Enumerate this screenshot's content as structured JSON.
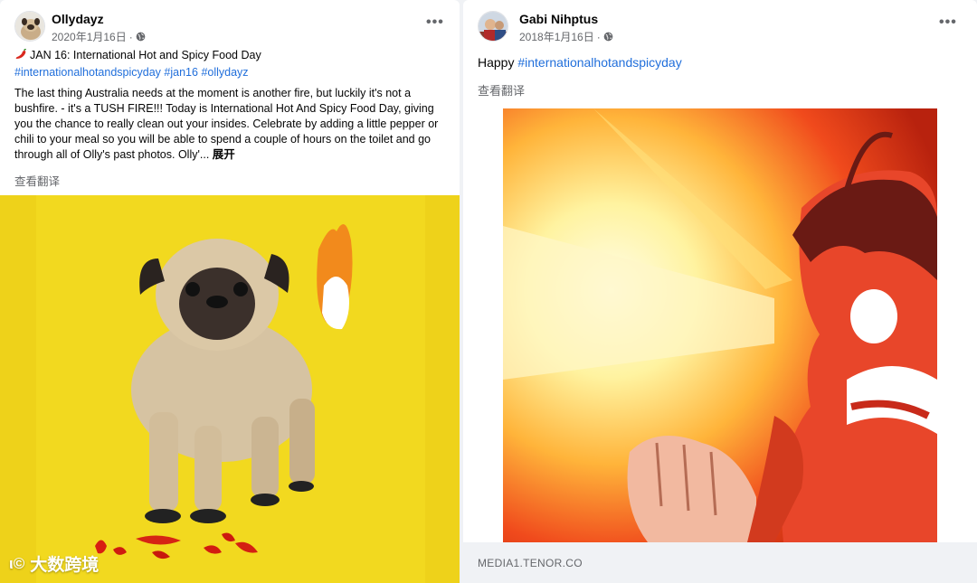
{
  "posts": [
    {
      "author": "Ollydayz",
      "date": "2020年1月16日",
      "separator": "·",
      "title_line": "JAN 16: International Hot and Spicy Food Day",
      "title_icon": "chili-pepper-icon",
      "hashtags": [
        "#internationalhotandspicyday",
        "#jan16",
        "#ollydayz"
      ],
      "body": "The last thing Australia needs at the moment is another fire, but luckily it's not a bushfire. - it's a TUSH FIRE!!! Today is International Hot And Spicy Food Day, giving you the chance to really clean out your insides. Celebrate by adding a little pepper or chili to your meal so you will be able to spend a couple of hours on the toilet and go through all of Olly's past photos. Olly'...",
      "expand_label": "展开",
      "translate_label": "查看翻译",
      "watermark": "大数跨境",
      "image_bg_color": "#f2d91f"
    },
    {
      "author": "Gabi Nihptus",
      "date": "2018年1月16日",
      "separator": "·",
      "text_prefix": "Happy",
      "hashtag": "#internationalhotandspicyday",
      "translate_label": "查看翻译",
      "link_domain": "MEDIA1.TENOR.CO"
    }
  ],
  "colors": {
    "hashtag": "#216fdb",
    "meta": "#65676b",
    "footer": "#f0f2f5"
  }
}
